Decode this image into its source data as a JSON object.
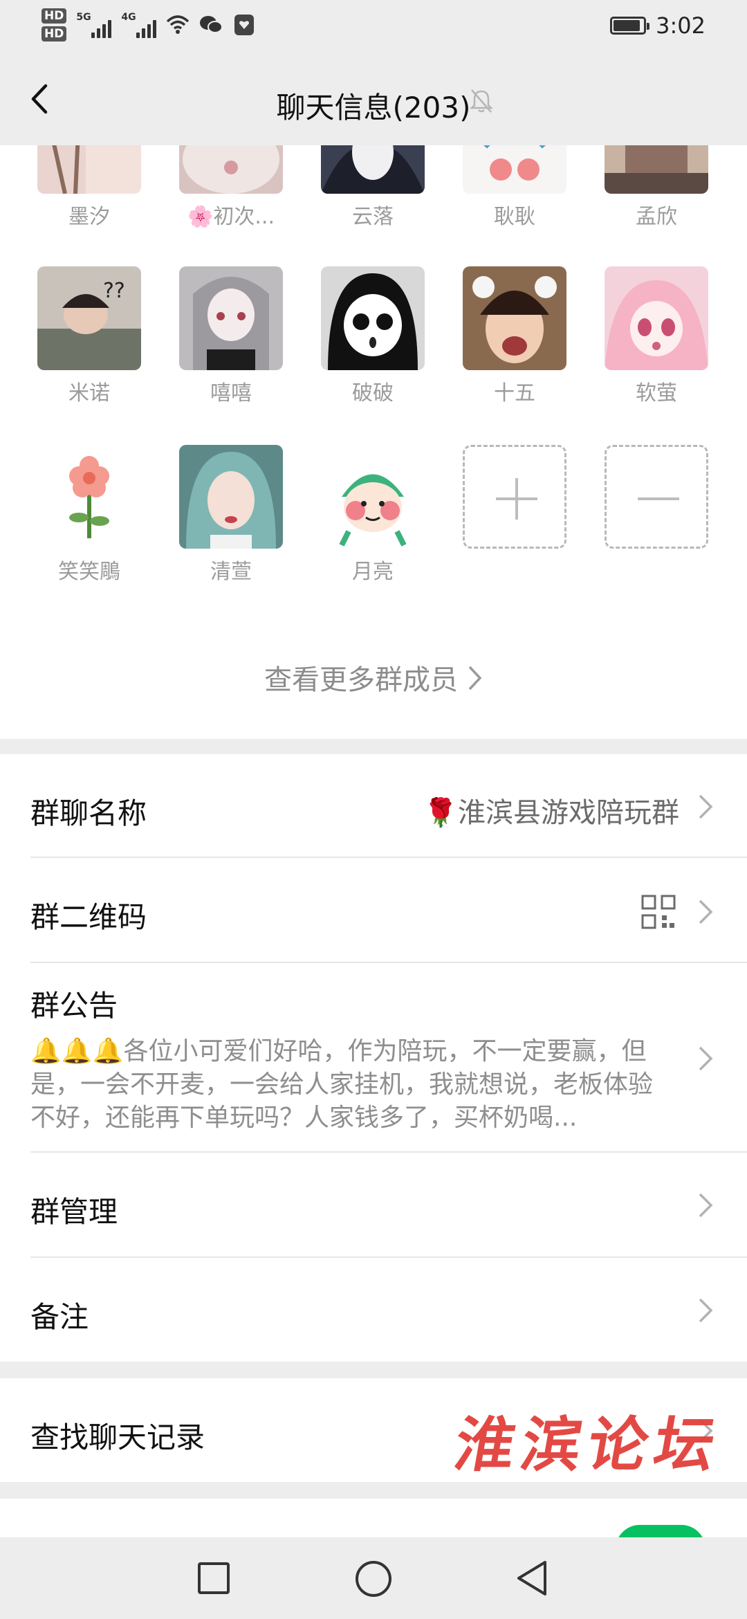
{
  "status": {
    "hd1": "HD",
    "hd2": "HD",
    "net1": "5G",
    "net2": "4G",
    "time": "3:02",
    "battery_level": 0.9
  },
  "nav": {
    "title": "聊天信息(203)"
  },
  "members": [
    {
      "name": "墨汐",
      "bg": "#e9d4cf"
    },
    {
      "name": "🌸初次...",
      "bg": "#d9c3c0"
    },
    {
      "name": "云落",
      "bg": "#3b3f52"
    },
    {
      "name": "耿耿",
      "bg": "#f2eeee"
    },
    {
      "name": "孟欣",
      "bg": "#c8b2a2"
    },
    {
      "name": "米诺",
      "bg": "#c8c2bb"
    },
    {
      "name": "嘻嘻",
      "bg": "#bdbbbe"
    },
    {
      "name": "破破",
      "bg": "#d8d8d8"
    },
    {
      "name": "十五",
      "bg": "#8a6a4f"
    },
    {
      "name": "软萤",
      "bg": "#f4d2dc"
    },
    {
      "name": "笑笑鵰",
      "bg": "#ffffff"
    },
    {
      "name": "清萱",
      "bg": "#5d8a89"
    },
    {
      "name": "月亮",
      "bg": "#ffffff"
    }
  ],
  "more_members": "查看更多群成员",
  "settings": {
    "group_name_label": "群聊名称",
    "group_name_value": "🌹淮滨县游戏陪玩群",
    "qr_label": "群二维码",
    "notice_label": "群公告",
    "notice_body": "🔔🔔🔔各位小可爱们好哈，作为陪玩，不一定要赢，但是，一会不开麦，一会给人家挂机，我就想说，老板体验不好，还能再下单玩吗？人家钱多了，买杯奶喝...",
    "manage_label": "群管理",
    "remark_label": "备注",
    "search_label": "查找聊天记录"
  },
  "watermark": "淮滨论坛",
  "colors": {
    "accent_green": "#07c160",
    "watermark_red": "#e2403a"
  }
}
